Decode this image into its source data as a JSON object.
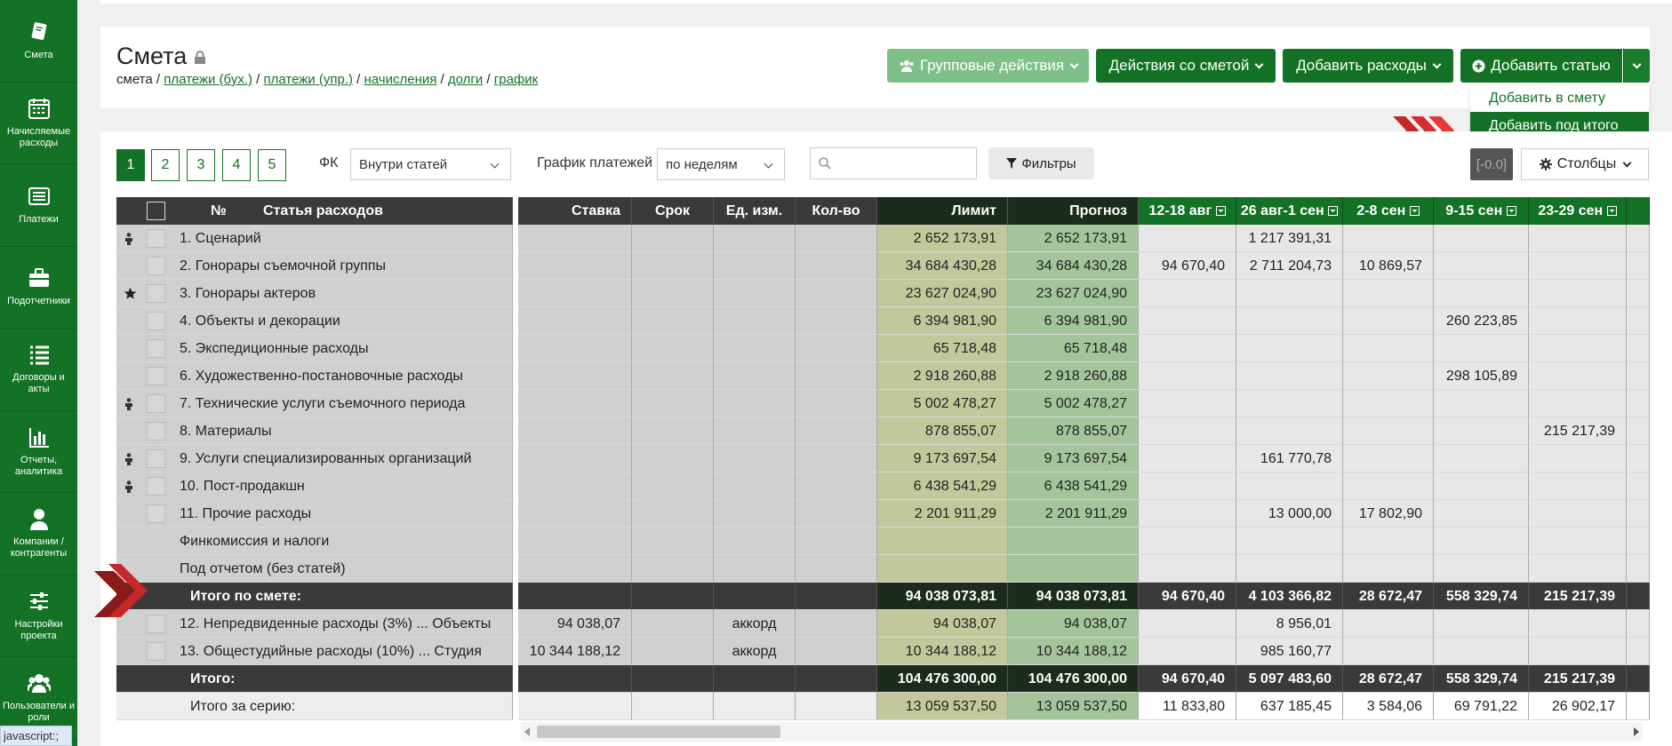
{
  "sidebar": {
    "items": [
      {
        "label": "Смета",
        "icon": "book-icon"
      },
      {
        "label": "Начисляемые расходы",
        "icon": "calendar-icon"
      },
      {
        "label": "Платежи",
        "icon": "payments-icon"
      },
      {
        "label": "Подотчетники",
        "icon": "briefcase-icon"
      },
      {
        "label": "Договоры и акты",
        "icon": "list-icon"
      },
      {
        "label": "Отчеты, аналитика",
        "icon": "bar-chart-icon"
      },
      {
        "label": "Компании / контрагенты",
        "icon": "user-icon"
      },
      {
        "label": "Настройки проекта",
        "icon": "sliders-icon"
      },
      {
        "label": "Пользователи и роли",
        "icon": "users-icon"
      }
    ]
  },
  "header": {
    "title": "Смета",
    "breadcrumb": {
      "current": "смета",
      "links": [
        "платежи (бух.)",
        "платежи (упр.)",
        "начисления",
        "долги",
        "график"
      ]
    },
    "buttons": {
      "group_actions": "Групповые действия",
      "estimate_actions": "Действия со сметой",
      "add_expenses": "Добавить расходы",
      "add_article": "Добавить статью"
    },
    "dropdown": {
      "item1": "Добавить в смету",
      "item2": "Добавить под итого"
    }
  },
  "toolbar": {
    "pages": [
      "1",
      "2",
      "3",
      "4",
      "5"
    ],
    "fk_label": "ФК",
    "fk_value": "Внутри статей",
    "schedule_label": "График платежей",
    "schedule_value": "по неделям",
    "search_placeholder": "",
    "filters": "Фильтры",
    "neg": "[-0.0]",
    "columns": "Столбцы"
  },
  "table": {
    "columns": {
      "no": "№",
      "article": "Статья расходов",
      "rate": "Ставка",
      "term": "Срок",
      "unit": "Ед. изм.",
      "qty": "Кол-во",
      "limit": "Лимит",
      "forecast": "Прогноз",
      "w1": "12-18 авг",
      "w2": "26 авг-1 сен",
      "w3": "2-8 сен",
      "w4": "9-15 сен",
      "w5": "23-29 сен"
    },
    "rows": [
      {
        "icon": "person",
        "name": "1. Сценарий",
        "rate": "",
        "unit": "",
        "limit": "2 652 173,91",
        "forecast": "2 652 173,91",
        "w1": "",
        "w2": "1 217 391,31",
        "w3": "",
        "w4": "",
        "w5": ""
      },
      {
        "icon": "",
        "name": "2. Гонорары съемочной группы",
        "rate": "",
        "unit": "",
        "limit": "34 684 430,28",
        "forecast": "34 684 430,28",
        "w1": "94 670,40",
        "w2": "2 711 204,73",
        "w3": "10 869,57",
        "w4": "",
        "w5": ""
      },
      {
        "icon": "star",
        "name": "3. Гонорары актеров",
        "rate": "",
        "unit": "",
        "limit": "23 627 024,90",
        "forecast": "23 627 024,90",
        "w1": "",
        "w2": "",
        "w3": "",
        "w4": "",
        "w5": ""
      },
      {
        "icon": "",
        "name": "4. Объекты и декорации",
        "rate": "",
        "unit": "",
        "limit": "6 394 981,90",
        "forecast": "6 394 981,90",
        "w1": "",
        "w2": "",
        "w3": "",
        "w4": "260 223,85",
        "w5": ""
      },
      {
        "icon": "",
        "name": "5. Экспедиционные расходы",
        "rate": "",
        "unit": "",
        "limit": "65 718,48",
        "forecast": "65 718,48",
        "w1": "",
        "w2": "",
        "w3": "",
        "w4": "",
        "w5": ""
      },
      {
        "icon": "",
        "name": "6. Художественно-постановочные расходы",
        "rate": "",
        "unit": "",
        "limit": "2 918 260,88",
        "forecast": "2 918 260,88",
        "w1": "",
        "w2": "",
        "w3": "",
        "w4": "298 105,89",
        "w5": ""
      },
      {
        "icon": "person",
        "name": "7. Технические услуги съемочного периода",
        "rate": "",
        "unit": "",
        "limit": "5 002 478,27",
        "forecast": "5 002 478,27",
        "w1": "",
        "w2": "",
        "w3": "",
        "w4": "",
        "w5": ""
      },
      {
        "icon": "",
        "name": "8. Материалы",
        "rate": "",
        "unit": "",
        "limit": "878 855,07",
        "forecast": "878 855,07",
        "w1": "",
        "w2": "",
        "w3": "",
        "w4": "",
        "w5": "215 217,39"
      },
      {
        "icon": "person",
        "name": "9. Услуги специализированных организаций",
        "rate": "",
        "unit": "",
        "limit": "9 173 697,54",
        "forecast": "9 173 697,54",
        "w1": "",
        "w2": "161 770,78",
        "w3": "",
        "w4": "",
        "w5": ""
      },
      {
        "icon": "person",
        "name": "10. Пост-продакшн",
        "rate": "",
        "unit": "",
        "limit": "6 438 541,29",
        "forecast": "6 438 541,29",
        "w1": "",
        "w2": "",
        "w3": "",
        "w4": "",
        "w5": ""
      },
      {
        "icon": "",
        "name": "11. Прочие расходы",
        "rate": "",
        "unit": "",
        "limit": "2 201 911,29",
        "forecast": "2 201 911,29",
        "w1": "",
        "w2": "13 000,00",
        "w3": "17 802,90",
        "w4": "",
        "w5": ""
      },
      {
        "icon": "",
        "name": "Финкомиссия и налоги",
        "nochk": true,
        "rate": "",
        "unit": "",
        "limit": "",
        "forecast": "",
        "w1": "",
        "w2": "",
        "w3": "",
        "w4": "",
        "w5": ""
      },
      {
        "icon": "",
        "name": "Под отчетом (без статей)",
        "nochk": true,
        "rate": "",
        "unit": "",
        "limit": "",
        "forecast": "",
        "w1": "",
        "w2": "",
        "w3": "",
        "w4": "",
        "w5": ""
      }
    ],
    "subtotal": {
      "name": "Итого по смете:",
      "limit": "94 038 073,81",
      "forecast": "94 038 073,81",
      "w1": "94 670,40",
      "w2": "4 103 366,82",
      "w3": "28 672,47",
      "w4": "558 329,74",
      "w5": "215 217,39"
    },
    "extra_rows": [
      {
        "name": "12. Непредвиденные расходы (3%) ... Объекты",
        "rate": "94 038,07",
        "unit": "аккорд",
        "limit": "94 038,07",
        "forecast": "94 038,07",
        "w1": "",
        "w2": "8 956,01",
        "w3": "",
        "w4": "",
        "w5": ""
      },
      {
        "name": "13. Общестудийные расходы (10%) ... Студия",
        "rate": "10 344 188,12",
        "unit": "аккорд",
        "limit": "10 344 188,12",
        "forecast": "10 344 188,12",
        "w1": "",
        "w2": "985 160,77",
        "w3": "",
        "w4": "",
        "w5": ""
      }
    ],
    "total": {
      "name": "Итого:",
      "limit": "104 476 300,00",
      "forecast": "104 476 300,00",
      "w1": "94 670,40",
      "w2": "5 097 483,60",
      "w3": "28 672,47",
      "w4": "558 329,74",
      "w5": "215 217,39"
    },
    "series_total": {
      "name": "Итого за серию:",
      "limit": "13 059 537,50",
      "forecast": "13 059 537,50",
      "w1": "11 833,80",
      "w2": "637 185,45",
      "w3": "3 584,06",
      "w4": "69 791,22",
      "w5": "26 902,17"
    }
  },
  "statusbar": "javascript:;"
}
